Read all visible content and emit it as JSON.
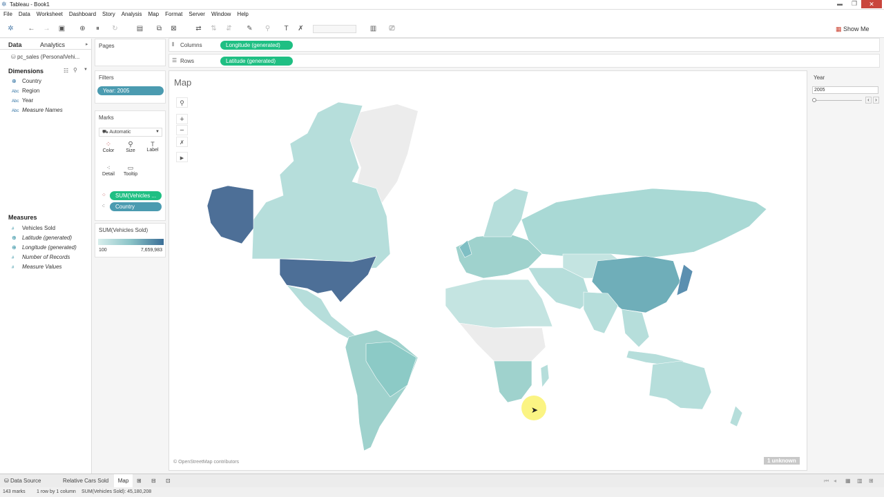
{
  "window": {
    "title": "Tableau - Book1"
  },
  "menu": [
    "File",
    "Data",
    "Worksheet",
    "Dashboard",
    "Story",
    "Analysis",
    "Map",
    "Format",
    "Server",
    "Window",
    "Help"
  ],
  "toolbar": {
    "show_me": "Show Me"
  },
  "datapane": {
    "tab_data": "Data",
    "tab_analytics": "Analytics",
    "datasource": "pc_sales (PersonalVehi...",
    "dimensions_label": "Dimensions",
    "dimensions": [
      {
        "type": "globe",
        "name": "Country"
      },
      {
        "type": "Abc",
        "name": "Region"
      },
      {
        "type": "Abc",
        "name": "Year"
      },
      {
        "type": "Abc",
        "name": "Measure Names"
      }
    ],
    "measures_label": "Measures",
    "measures": [
      {
        "name": "Vehicles Sold"
      },
      {
        "name": "Latitude (generated)"
      },
      {
        "name": "Longitude (generated)"
      },
      {
        "name": "Number of Records"
      },
      {
        "name": "Measure Values"
      }
    ]
  },
  "cards": {
    "pages_label": "Pages",
    "filters_label": "Filters",
    "filter_pill": "Year: 2005",
    "marks_label": "Marks",
    "mark_type": "Automatic",
    "mark_buttons": [
      "Color",
      "Size",
      "Label",
      "Detail",
      "Tooltip"
    ],
    "mark_pills": [
      "SUM(Vehicles ...",
      "Country"
    ],
    "legend_title": "SUM(Vehicles Sold)",
    "legend_min": "100",
    "legend_max": "7,659,983",
    "colors": {
      "legend_low": "#d8eeec",
      "legend_high": "#3b6e96"
    }
  },
  "shelves": {
    "columns_label": "Columns",
    "columns_pill": "Longitude (generated)",
    "rows_label": "Rows",
    "rows_pill": "Latitude (generated)"
  },
  "view": {
    "title": "Map",
    "attribution": "© OpenStreetMap contributors",
    "unknown": "1 unknown"
  },
  "yearfilter": {
    "title": "Year",
    "value": "2005"
  },
  "bottomtabs": [
    "Data Source",
    "Relative Cars Sold",
    "Map"
  ],
  "status": {
    "marks": "143 marks",
    "rows": "1 row by 1 column",
    "sum": "SUM(Vehicles Sold): 45,180,208"
  }
}
